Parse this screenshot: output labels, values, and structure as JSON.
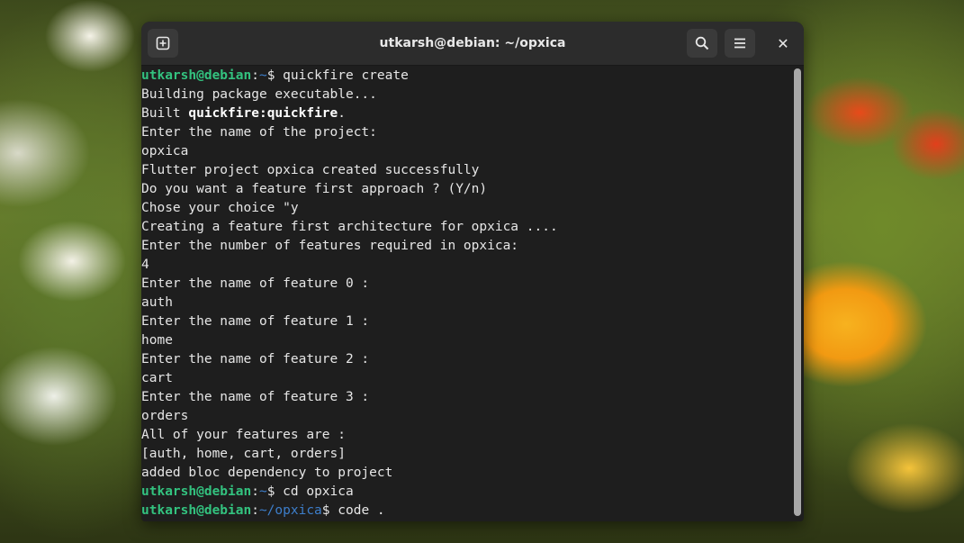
{
  "window": {
    "title": "utkarsh@debian: ~/opxica",
    "close_glyph": "✕",
    "icons": {
      "new_tab": "new-tab-icon",
      "search": "search-icon",
      "menu": "hamburger-menu-icon",
      "close": "close-icon"
    }
  },
  "colors": {
    "prompt_user": "#33c27f",
    "prompt_path": "#3d7ecb",
    "terminal_bg": "#1e1e1e",
    "text": "#e6e6e6"
  },
  "terminal": {
    "lines": [
      {
        "type": "prompt",
        "user": "utkarsh@debian",
        "sep": ":",
        "path": "~",
        "sym": "$ ",
        "cmd": "quickfire create"
      },
      {
        "type": "text",
        "text": "Building package executable..."
      },
      {
        "type": "built",
        "pre": "Built ",
        "bold": "quickfire:quickfire",
        "post": "."
      },
      {
        "type": "text",
        "text": "Enter the name of the project:"
      },
      {
        "type": "text",
        "text": "opxica"
      },
      {
        "type": "text",
        "text": "Flutter project opxica created successfully"
      },
      {
        "type": "text",
        "text": "Do you want a feature first approach ? (Y/n)"
      },
      {
        "type": "text",
        "text": "Chose your choice \"y"
      },
      {
        "type": "text",
        "text": "Creating a feature first architecture for opxica ...."
      },
      {
        "type": "text",
        "text": "Enter the number of features required in opxica:"
      },
      {
        "type": "text",
        "text": "4"
      },
      {
        "type": "text",
        "text": "Enter the name of feature 0 :"
      },
      {
        "type": "text",
        "text": "auth"
      },
      {
        "type": "text",
        "text": "Enter the name of feature 1 :"
      },
      {
        "type": "text",
        "text": "home"
      },
      {
        "type": "text",
        "text": "Enter the name of feature 2 :"
      },
      {
        "type": "text",
        "text": "cart"
      },
      {
        "type": "text",
        "text": "Enter the name of feature 3 :"
      },
      {
        "type": "text",
        "text": "orders"
      },
      {
        "type": "text",
        "text": "All of your features are :"
      },
      {
        "type": "text",
        "text": "[auth, home, cart, orders]"
      },
      {
        "type": "text",
        "text": "added bloc dependency to project"
      },
      {
        "type": "prompt",
        "user": "utkarsh@debian",
        "sep": ":",
        "path": "~",
        "sym": "$ ",
        "cmd": "cd opxica"
      },
      {
        "type": "prompt",
        "user": "utkarsh@debian",
        "sep": ":",
        "path": "~/opxica",
        "sym": "$ ",
        "cmd": "code ."
      }
    ]
  }
}
